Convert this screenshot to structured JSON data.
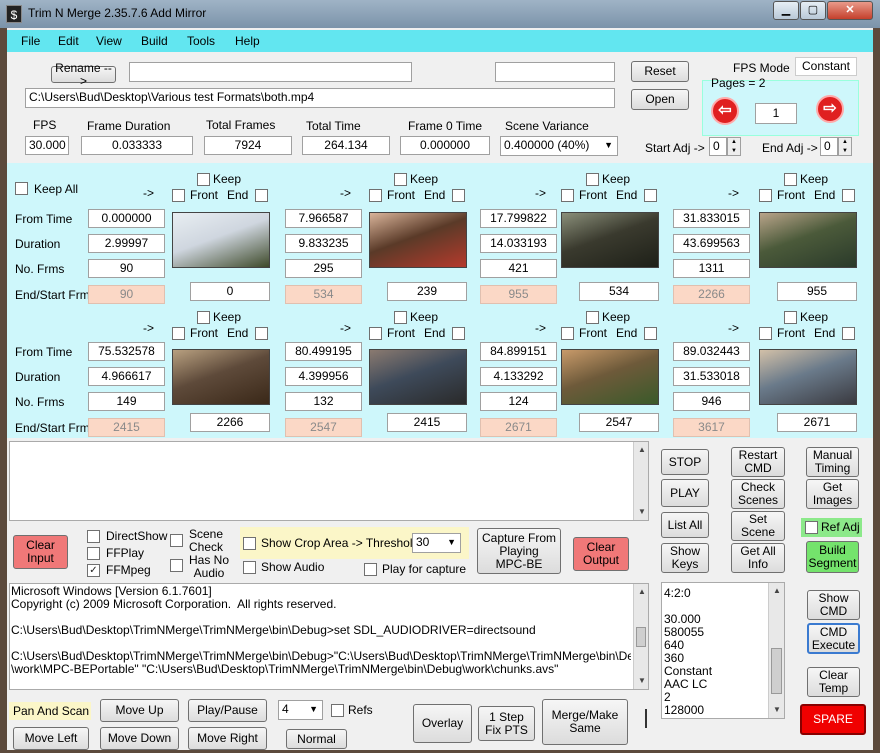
{
  "title": "Trim N Merge 2.35.7.6 Add Mirror",
  "app_icon": "$",
  "menu": [
    "File",
    "Edit",
    "View",
    "Build",
    "Tools",
    "Help"
  ],
  "top": {
    "rename_label": "Rename -->",
    "rename_value": "",
    "rename2_value": "",
    "path": "C:\\Users\\Bud\\Desktop\\Various test Formats\\both.mp4",
    "reset": "Reset",
    "open": "Open",
    "fps_mode_label": "FPS Mode",
    "fps_mode_value": "Constant",
    "pages_label": "Pages = 2",
    "page_value": "1",
    "fps_label": "FPS",
    "fps_value": "30.000",
    "frame_duration_label": "Frame Duration",
    "frame_duration_value": "0.033333",
    "total_frames_label": "Total Frames",
    "total_frames_value": "7924",
    "total_time_label": "Total Time",
    "total_time_value": "264.134",
    "frame0_label": "Frame 0 Time",
    "frame0_value": "0.000000",
    "scene_var_label": "Scene Variance",
    "scene_var_value": "0.400000  (40%)",
    "start_adj_label": "Start Adj ->",
    "start_adj_value": "0",
    "end_adj_label": "End Adj ->",
    "end_adj_value": "0"
  },
  "grid": {
    "keep_all": "Keep All",
    "arrow": "->",
    "keep": "Keep",
    "front": "Front",
    "end": "End",
    "from_time": "From Time",
    "duration": "Duration",
    "no_frms": "No. Frms",
    "end_start": "End/Start Frm",
    "row1": [
      {
        "from": "0.000000",
        "dur": "2.99997",
        "frms": "90",
        "end": "90",
        "start": "0"
      },
      {
        "from": "7.966587",
        "dur": "9.833235",
        "frms": "295",
        "end": "534",
        "start": "239"
      },
      {
        "from": "17.799822",
        "dur": "14.033193",
        "frms": "421",
        "end": "955",
        "start": "534"
      },
      {
        "from": "31.833015",
        "dur": "43.699563",
        "frms": "1311",
        "end": "2266",
        "start": "955"
      }
    ],
    "row2": [
      {
        "from": "75.532578",
        "dur": "4.966617",
        "frms": "149",
        "end": "2415",
        "start": "2266"
      },
      {
        "from": "80.499195",
        "dur": "4.399956",
        "frms": "132",
        "end": "2547",
        "start": "2415"
      },
      {
        "from": "84.899151",
        "dur": "4.133292",
        "frms": "124",
        "end": "2671",
        "start": "2547"
      },
      {
        "from": "89.032443",
        "dur": "31.533018",
        "frms": "946",
        "end": "3617",
        "start": "2671"
      }
    ]
  },
  "controls": {
    "stop": "STOP",
    "play": "PLAY",
    "list_all": "List All",
    "show_keys": "Show\nKeys",
    "restart_cmd": "Restart\nCMD",
    "check_scenes": "Check\nScenes",
    "set_scene": "Set\nScene",
    "get_all_info": "Get All\nInfo",
    "manual_timing": "Manual\nTiming",
    "get_images": "Get\nImages",
    "ref_adj": "Ref Adj",
    "build_segment": "Build\nSegment",
    "clear_input": "Clear\nInput",
    "directshow": "DirectShow",
    "ffplay": "FFPlay",
    "ffmpeg": "FFMpeg",
    "scene_check": "Scene\nCheck",
    "has_no_audio": "Has No\nAudio",
    "show_crop": "Show Crop Area -> Threshold",
    "threshold": "30",
    "show_audio": "Show Audio",
    "play_capture": "Play for capture",
    "capture_mpc": "Capture From\nPlaying\nMPC-BE",
    "clear_output": "Clear\nOutput",
    "show_cmd": "Show\nCMD",
    "cmd_execute": "CMD\nExecute",
    "clear_temp": "Clear\nTemp",
    "spare": "SPARE"
  },
  "console": "Microsoft Windows [Version 6.1.7601]\nCopyright (c) 2009 Microsoft Corporation.  All rights reserved.\n\nC:\\Users\\Bud\\Desktop\\TrimNMerge\\TrimNMerge\\bin\\Debug>set SDL_AUDIODRIVER=directsound\n\nC:\\Users\\Bud\\Desktop\\TrimNMerge\\TrimNMerge\\bin\\Debug>\"C:\\Users\\Bud\\Desktop\\TrimNMerge\\TrimNMerge\\bin\\Debug\n\\work\\MPC-BEPortable\" \"C:\\Users\\Bud\\Desktop\\TrimNMerge\\TrimNMerge\\bin\\Debug\\work\\chunks.avs\"",
  "info": "4:2:0\n\n30.000\n580055\n640\n360\nConstant\nAAC LC\n2\n128000",
  "bottom": {
    "pan_scan": "Pan  And  Scan",
    "move_up": "Move Up",
    "play_pause": "Play/Pause",
    "step_value": "4",
    "refs": "Refs",
    "move_left": "Move Left",
    "move_down": "Move Down",
    "move_right": "Move Right",
    "normal": "Normal",
    "overlay": "Overlay",
    "one_step": "1 Step\nFix PTS",
    "merge_make": "Merge/Make\nSame"
  }
}
